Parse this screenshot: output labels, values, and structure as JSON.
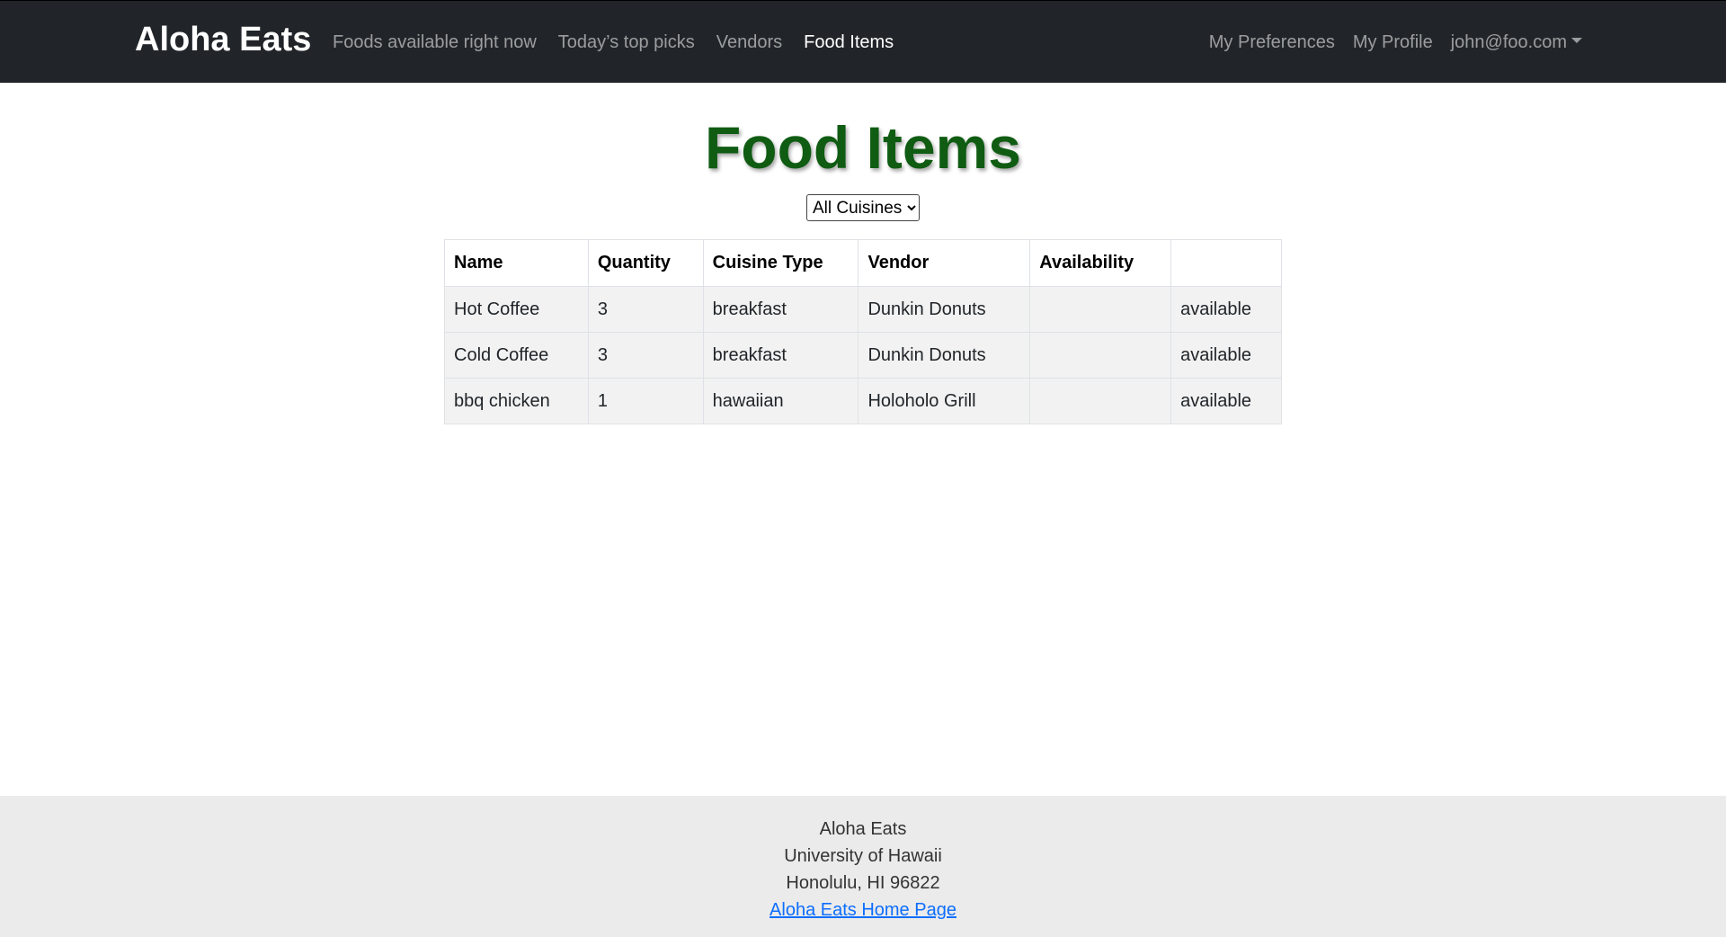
{
  "navbar": {
    "brand": "Aloha Eats",
    "left_links": [
      {
        "label": "Foods available right now",
        "active": false
      },
      {
        "label": "Today’s top picks",
        "active": false
      },
      {
        "label": "Vendors",
        "active": false
      },
      {
        "label": "Food Items",
        "active": true
      }
    ],
    "right_links": [
      {
        "label": "My Preferences"
      },
      {
        "label": "My Profile"
      }
    ],
    "user_menu": "john@foo.com"
  },
  "page": {
    "title": "Food Items",
    "filter": {
      "selected": "All Cuisines"
    }
  },
  "table": {
    "headers": [
      "Name",
      "Quantity",
      "Cuisine Type",
      "Vendor",
      "Availability",
      ""
    ],
    "rows": [
      [
        "Hot Coffee",
        "3",
        "breakfast",
        "Dunkin Donuts",
        "",
        "available"
      ],
      [
        "Cold Coffee",
        "3",
        "breakfast",
        "Dunkin Donuts",
        "",
        "available"
      ],
      [
        "bbq chicken",
        "1",
        "hawaiian",
        "Holoholo Grill",
        "",
        "available"
      ]
    ]
  },
  "footer": {
    "line1": "Aloha Eats",
    "line2": "University of Hawaii",
    "line3": "Honolulu, HI 96822",
    "link": "Aloha Eats Home Page"
  },
  "colors": {
    "navbar_bg": "#212529",
    "title_green": "#0f5c12",
    "row_bg": "#f2f2f2",
    "footer_bg": "#ebebeb",
    "link_blue": "#0d6efd"
  }
}
